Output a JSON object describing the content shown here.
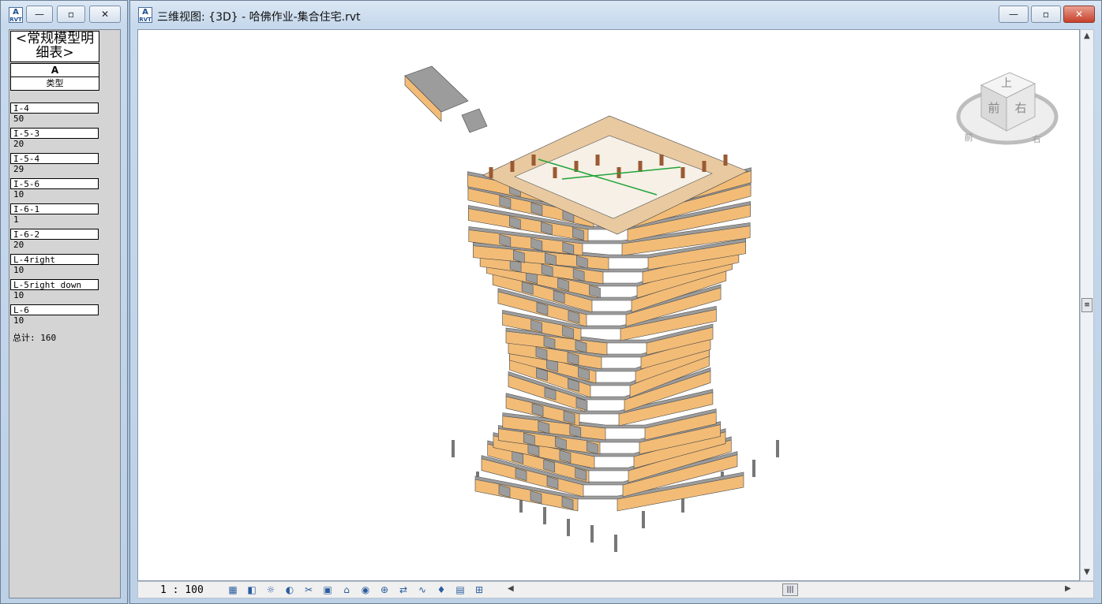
{
  "schedule_window": {
    "icon_label": "RVT",
    "minimize": "—",
    "maximize": "▫",
    "close": "✕",
    "title": "<常规模型明细表>",
    "column_letter": "A",
    "column_header": "类型",
    "rows": [
      {
        "type": "I-4",
        "count": "50"
      },
      {
        "type": "I-5-3",
        "count": "20"
      },
      {
        "type": "I-5-4",
        "count": "29"
      },
      {
        "type": "I-5-6",
        "count": "10"
      },
      {
        "type": "I-6-1",
        "count": "1"
      },
      {
        "type": "I-6-2",
        "count": "20"
      },
      {
        "type": "L-4right",
        "count": "10"
      },
      {
        "type": "L-5right down",
        "count": "10"
      },
      {
        "type": "L-6",
        "count": "10"
      }
    ],
    "total": "总计: 160"
  },
  "view_window": {
    "icon_label": "RVT",
    "title": "三维视图: {3D} - 哈佛作业-集合住宅.rvt",
    "minimize": "—",
    "maximize": "▫",
    "close": "✕",
    "viewcube": {
      "top": "上",
      "front": "前",
      "right": "右",
      "ring_front": "前",
      "ring_right": "右"
    },
    "scale": "1 : 100",
    "toolbar_icons": [
      "detail-level-icon",
      "visual-style-icon",
      "sun-path-icon",
      "shadows-icon",
      "crop-view-icon",
      "show-crop-icon",
      "unlock-3d-icon",
      "temporary-hide-icon",
      "reveal-hidden-icon",
      "worksharing-icon",
      "analysis-icon",
      "highlight-icon",
      "render-icon",
      "design-options-icon"
    ]
  },
  "colors": {
    "panel_face": "#f2bc77",
    "slab": "#9c9c9c",
    "window": "#9a5a32",
    "floor_line": "#22a43a"
  }
}
